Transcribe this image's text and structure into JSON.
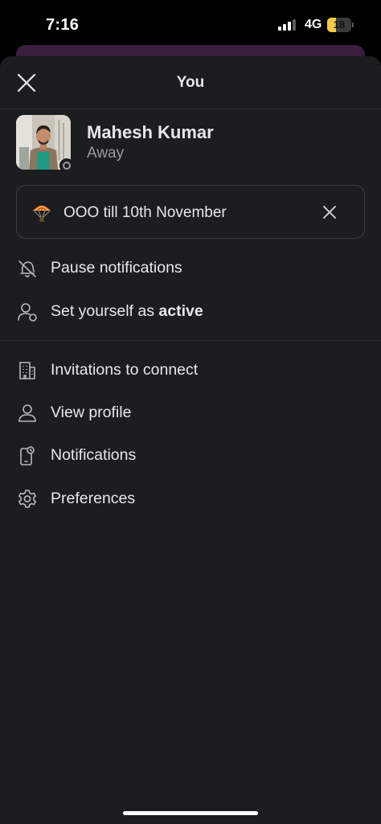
{
  "status_bar": {
    "time": "7:16",
    "network": "4G",
    "battery_level": "18",
    "signal_bars_active": 3,
    "signal_bars_total": 4
  },
  "header": {
    "title": "You",
    "close_icon": "close-icon"
  },
  "profile": {
    "name": "Mahesh Kumar",
    "presence": "Away"
  },
  "custom_status": {
    "emoji_icon": "parachute-emoji",
    "text": "OOO till 10th November",
    "clear_icon": "close-icon"
  },
  "menu_primary": [
    {
      "icon": "bell-off-icon",
      "label": "Pause notifications"
    },
    {
      "icon": "person-status-icon",
      "label_prefix": "Set yourself as ",
      "label_bold": "active"
    }
  ],
  "menu_secondary": [
    {
      "icon": "building-icon",
      "label": "Invitations to connect"
    },
    {
      "icon": "person-icon",
      "label": "View profile"
    },
    {
      "icon": "mobile-notification-icon",
      "label": "Notifications"
    },
    {
      "icon": "gear-icon",
      "label": "Preferences"
    }
  ],
  "colors": {
    "background": "#000000",
    "sheet": "#1b1d21",
    "text": "#e8e8e9",
    "muted": "#9a9b9e",
    "border": "#3a3c41",
    "battery": "#f2c94c",
    "peek": "#3b1d3d"
  }
}
